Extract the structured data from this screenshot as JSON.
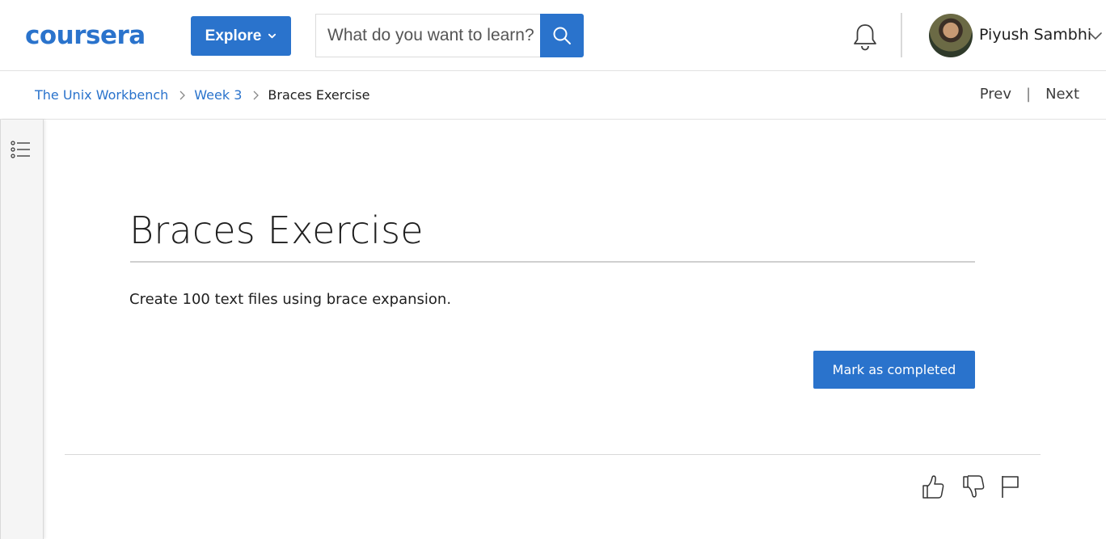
{
  "header": {
    "logo_text": "coursera",
    "explore_label": "Explore",
    "search_placeholder": "What do you want to learn?",
    "user_name": "Piyush Sambhi",
    "brand_color": "#2a73cc"
  },
  "breadcrumb": {
    "items": [
      "The Unix Workbench",
      "Week 3"
    ],
    "current": "Braces Exercise"
  },
  "nav": {
    "prev_label": "Prev",
    "next_label": "Next"
  },
  "main": {
    "title": "Braces Exercise",
    "body_text": "Create 100 text files using brace expansion.",
    "complete_button_label": "Mark as completed"
  },
  "icons": {
    "search": "search-icon",
    "bell": "bell-icon",
    "menu": "list-menu-icon",
    "like": "thumbs-up-icon",
    "dislike": "thumbs-down-icon",
    "flag": "flag-icon"
  }
}
